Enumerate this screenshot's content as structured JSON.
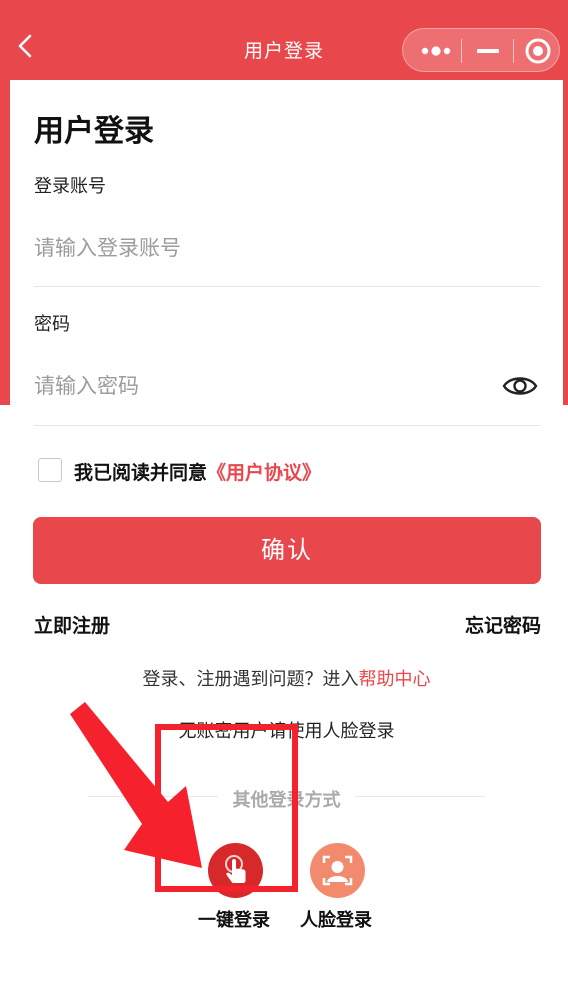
{
  "header": {
    "title": "用户登录",
    "capsule": {
      "more_icon": "more-dots-icon",
      "minimize_icon": "minimize-icon",
      "close_icon": "target-circle-icon"
    }
  },
  "form": {
    "page_title": "用户登录",
    "account": {
      "label": "登录账号",
      "placeholder": "请输入登录账号",
      "value": ""
    },
    "password": {
      "label": "密码",
      "placeholder": "请输入密码",
      "value": ""
    },
    "agreement": {
      "text": "我已阅读并同意",
      "link": "《用户协议》",
      "checked": false
    },
    "confirm_label": "确认",
    "register_label": "立即注册",
    "forgot_label": "忘记密码",
    "help": {
      "text": "登录、注册遇到问题？进入",
      "link": "帮助中心"
    },
    "no_account_hint": "无账密用户请使用人脸登录"
  },
  "other_methods": {
    "title": "其他登录方式",
    "items": [
      {
        "label": "一键登录",
        "icon": "tap-finger-icon",
        "color": "#d7282a"
      },
      {
        "label": "人脸登录",
        "icon": "face-scan-icon",
        "color": "#f28a6e"
      }
    ]
  },
  "annotation": {
    "color": "#f5222d"
  },
  "colors": {
    "accent": "#e8474b"
  }
}
